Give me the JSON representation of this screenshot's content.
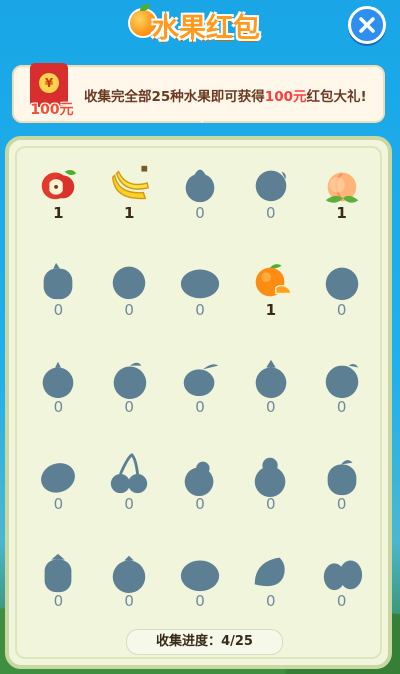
{
  "header": {
    "title": "水果红包"
  },
  "banner": {
    "envelope_symbol": "¥",
    "envelope_amount": "100元",
    "message_prefix": "收集完全部25种水果即可获得",
    "message_highlight": "100元",
    "message_suffix": "红包大礼!"
  },
  "fruits": [
    {
      "name": "apple",
      "count": "1",
      "owned": true
    },
    {
      "name": "banana",
      "count": "1",
      "owned": true
    },
    {
      "name": "mystery-1",
      "count": "0",
      "owned": false
    },
    {
      "name": "mystery-2",
      "count": "0",
      "owned": false
    },
    {
      "name": "peach",
      "count": "1",
      "owned": true
    },
    {
      "name": "mystery-3",
      "count": "0",
      "owned": false
    },
    {
      "name": "mystery-4",
      "count": "0",
      "owned": false
    },
    {
      "name": "mystery-5",
      "count": "0",
      "owned": false
    },
    {
      "name": "orange",
      "count": "1",
      "owned": true
    },
    {
      "name": "mystery-6",
      "count": "0",
      "owned": false
    },
    {
      "name": "mystery-7",
      "count": "0",
      "owned": false
    },
    {
      "name": "mystery-8",
      "count": "0",
      "owned": false
    },
    {
      "name": "mystery-9",
      "count": "0",
      "owned": false
    },
    {
      "name": "mystery-10",
      "count": "0",
      "owned": false
    },
    {
      "name": "mystery-11",
      "count": "0",
      "owned": false
    },
    {
      "name": "mystery-12",
      "count": "0",
      "owned": false
    },
    {
      "name": "cherry",
      "count": "0",
      "owned": false
    },
    {
      "name": "mystery-13",
      "count": "0",
      "owned": false
    },
    {
      "name": "mystery-14",
      "count": "0",
      "owned": false
    },
    {
      "name": "mystery-15",
      "count": "0",
      "owned": false
    },
    {
      "name": "mystery-16",
      "count": "0",
      "owned": false
    },
    {
      "name": "mystery-17",
      "count": "0",
      "owned": false
    },
    {
      "name": "mystery-18",
      "count": "0",
      "owned": false
    },
    {
      "name": "mystery-19",
      "count": "0",
      "owned": false
    },
    {
      "name": "mystery-20",
      "count": "0",
      "owned": false
    }
  ],
  "progress": {
    "label": "收集进度：",
    "value": "4/25"
  }
}
